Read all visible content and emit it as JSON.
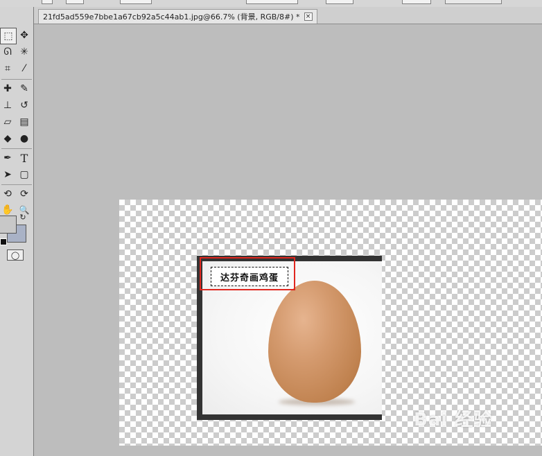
{
  "document": {
    "tab_title": "21fd5ad559e7bbe1a67cb92a5c44ab1.jpg@66.7% (背景, RGB/8#) *",
    "close_label": "×"
  },
  "toolbox": {
    "tools": [
      {
        "name": "rectangular-marquee-tool",
        "glyph": "⬚"
      },
      {
        "name": "move-tool",
        "glyph": "✥"
      },
      {
        "name": "lasso-tool",
        "glyph": "ᘏ"
      },
      {
        "name": "magic-wand-tool",
        "glyph": "✳"
      },
      {
        "name": "crop-tool",
        "glyph": "⌗"
      },
      {
        "name": "eyedropper-tool",
        "glyph": "⁄"
      },
      {
        "name": "healing-brush-tool",
        "glyph": "✚"
      },
      {
        "name": "brush-tool",
        "glyph": "✎"
      },
      {
        "name": "clone-stamp-tool",
        "glyph": "⊥"
      },
      {
        "name": "history-brush-tool",
        "glyph": "↺"
      },
      {
        "name": "eraser-tool",
        "glyph": "▱"
      },
      {
        "name": "gradient-tool",
        "glyph": "▤"
      },
      {
        "name": "blur-tool",
        "glyph": "◆"
      },
      {
        "name": "dodge-tool",
        "glyph": "●"
      },
      {
        "name": "pen-tool",
        "glyph": "✒"
      },
      {
        "name": "type-tool",
        "glyph": "T"
      },
      {
        "name": "path-selection-tool",
        "glyph": "➤"
      },
      {
        "name": "shape-tool",
        "glyph": "▢"
      },
      {
        "name": "3d-rotate-tool",
        "glyph": "⟲"
      },
      {
        "name": "3d-orbit-tool",
        "glyph": "⟳"
      },
      {
        "name": "hand-tool",
        "glyph": "✋"
      },
      {
        "name": "zoom-tool",
        "glyph": "🔍"
      }
    ],
    "quick_mask_glyph": "◯",
    "swap_colors_glyph": "↻"
  },
  "canvas": {
    "text_layer": "达芬奇画鸡蛋",
    "watermark": "Bai 经验"
  },
  "colors": {
    "annotation_red": "#e0261e",
    "foreground": "#c8c8c8",
    "background": "#a9b2c6"
  }
}
